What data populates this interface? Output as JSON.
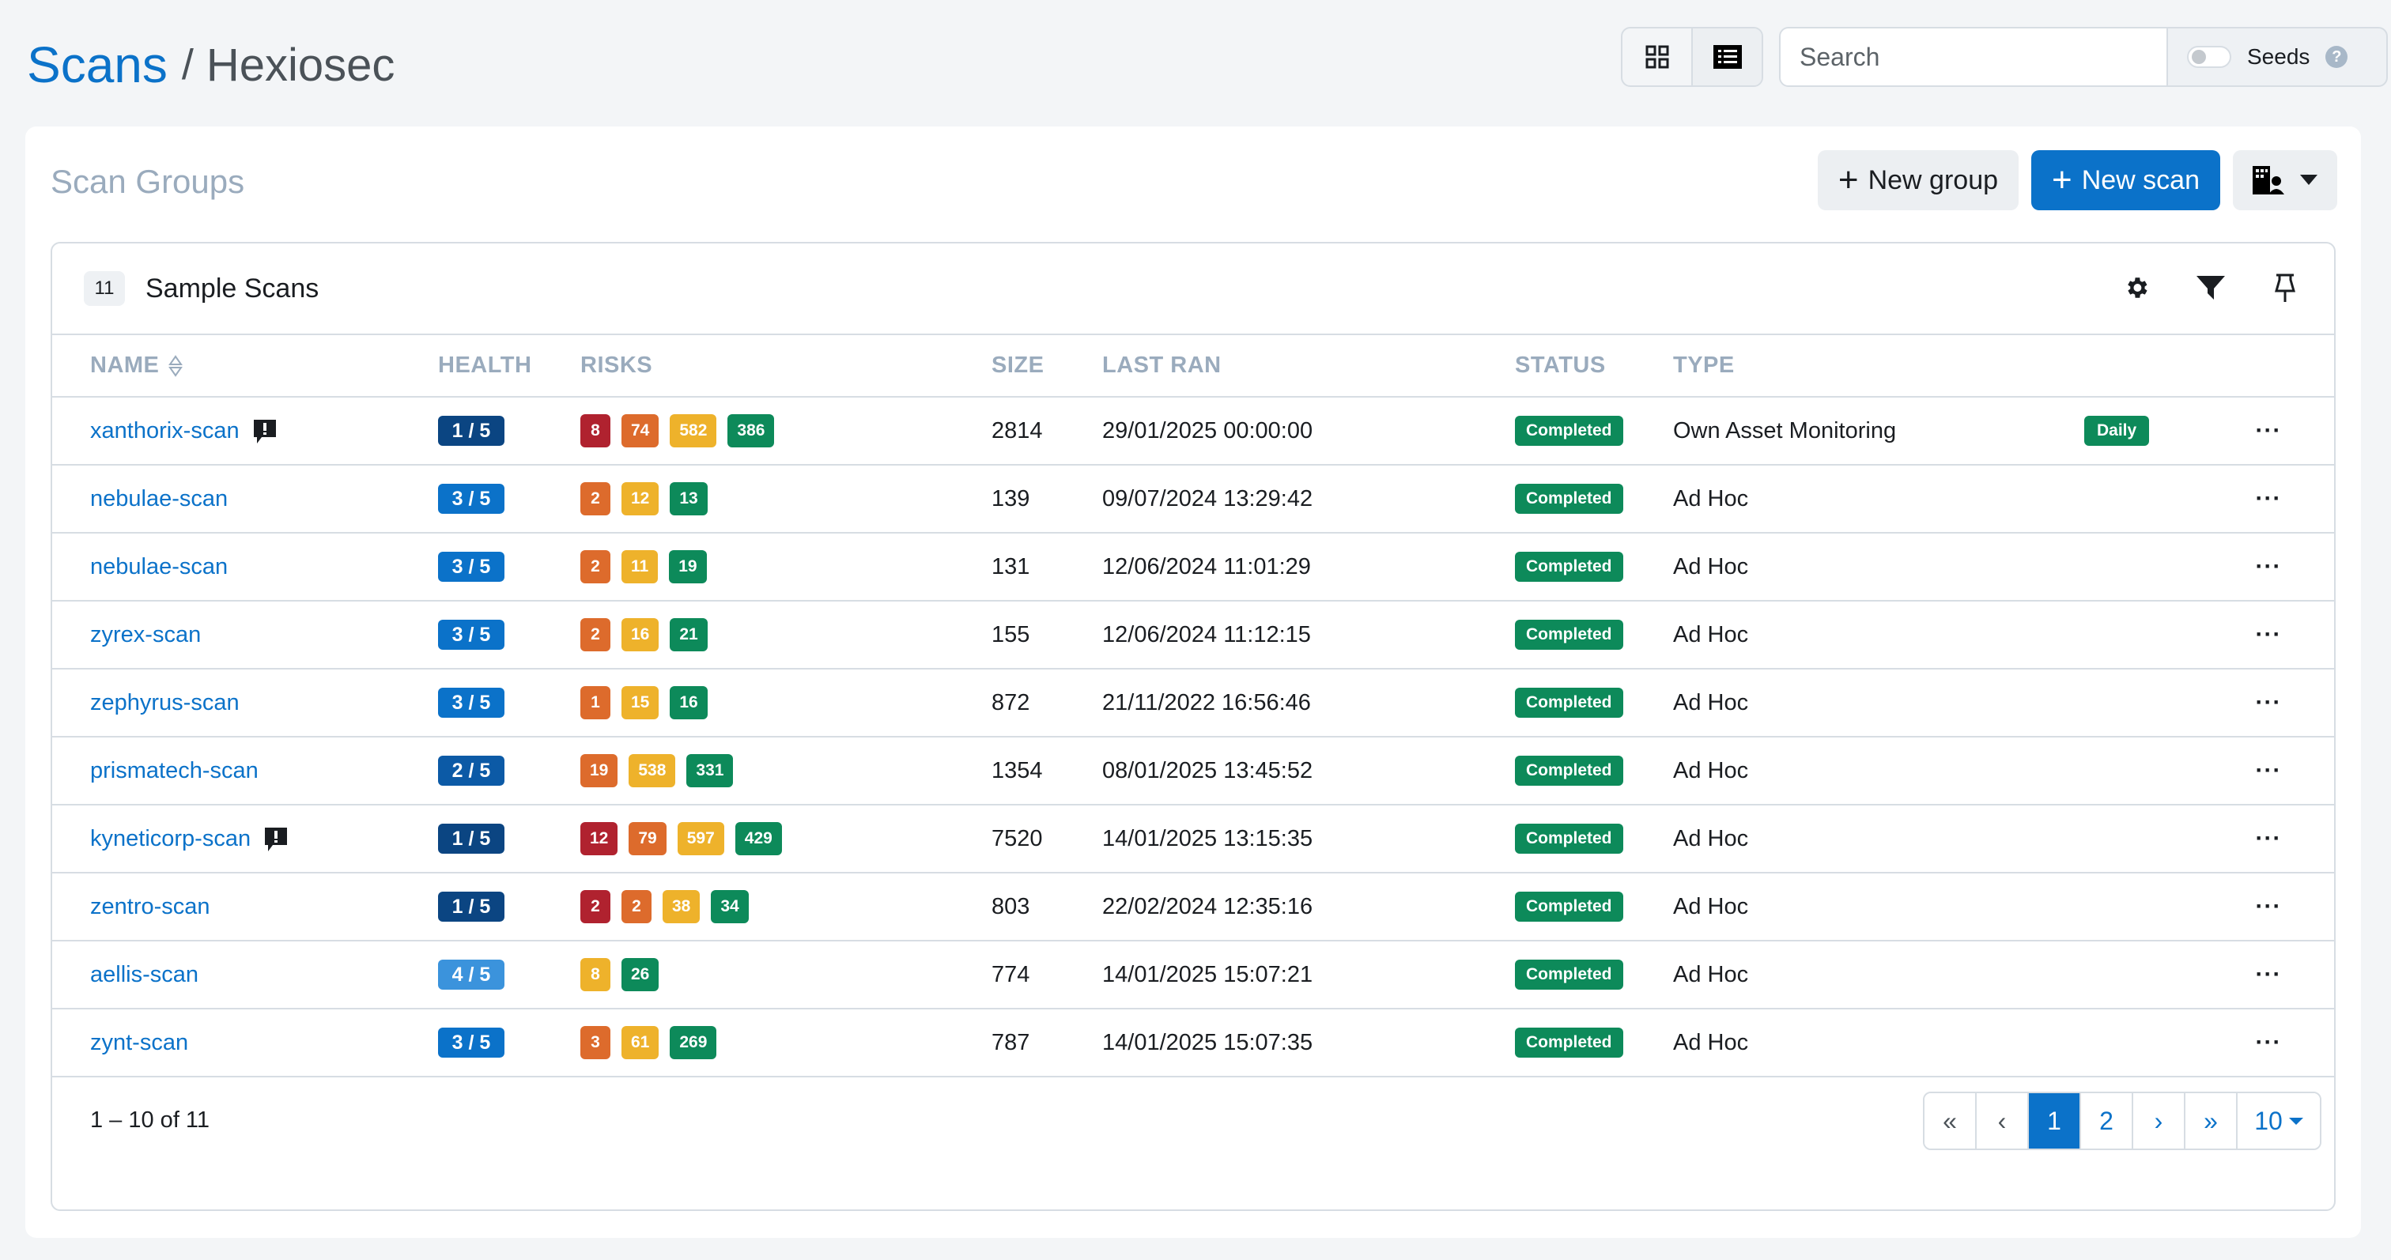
{
  "breadcrumb": {
    "parent": "Scans",
    "separator": "/",
    "current": "Hexiosec"
  },
  "toolbar": {
    "view_grid": "grid-view-icon",
    "view_list": "list-view-icon",
    "search_placeholder": "Search",
    "seeds_label": "Seeds",
    "seeds_help": "?"
  },
  "card": {
    "title": "Scan Groups",
    "new_group": "New group",
    "new_scan": "New scan",
    "plus": "+"
  },
  "group": {
    "count": "11",
    "name": "Sample Scans",
    "icons": [
      "gear-icon",
      "filter-icon",
      "pin-icon"
    ]
  },
  "columns": [
    "NAME",
    "HEALTH",
    "RISKS",
    "SIZE",
    "LAST RAN",
    "STATUS",
    "TYPE"
  ],
  "colors": {
    "critical": "#b0222f",
    "high": "#dd6b2c",
    "medium": "#eeb22b",
    "low": "#0d8a5a",
    "health_1": "#0b4582",
    "health_2": "#0c5aa6",
    "health_3": "#0b72c9",
    "health_4": "#3b93dc"
  },
  "rows": [
    {
      "name": "xanthorix-scan",
      "comment": true,
      "health": "1 / 5",
      "health_level": 1,
      "risks": [
        {
          "v": "8",
          "s": "critical"
        },
        {
          "v": "74",
          "s": "high"
        },
        {
          "v": "582",
          "s": "medium"
        },
        {
          "v": "386",
          "s": "low"
        }
      ],
      "size": "2814",
      "last_ran": "29/01/2025 00:00:00",
      "status": "Completed",
      "type": "Own Asset Monitoring",
      "frequency": "Daily"
    },
    {
      "name": "nebulae-scan",
      "comment": false,
      "health": "3 / 5",
      "health_level": 3,
      "risks": [
        {
          "v": "2",
          "s": "high"
        },
        {
          "v": "12",
          "s": "medium"
        },
        {
          "v": "13",
          "s": "low"
        }
      ],
      "size": "139",
      "last_ran": "09/07/2024 13:29:42",
      "status": "Completed",
      "type": "Ad Hoc",
      "frequency": ""
    },
    {
      "name": "nebulae-scan",
      "comment": false,
      "health": "3 / 5",
      "health_level": 3,
      "risks": [
        {
          "v": "2",
          "s": "high"
        },
        {
          "v": "11",
          "s": "medium"
        },
        {
          "v": "19",
          "s": "low"
        }
      ],
      "size": "131",
      "last_ran": "12/06/2024 11:01:29",
      "status": "Completed",
      "type": "Ad Hoc",
      "frequency": ""
    },
    {
      "name": "zyrex-scan",
      "comment": false,
      "health": "3 / 5",
      "health_level": 3,
      "risks": [
        {
          "v": "2",
          "s": "high"
        },
        {
          "v": "16",
          "s": "medium"
        },
        {
          "v": "21",
          "s": "low"
        }
      ],
      "size": "155",
      "last_ran": "12/06/2024 11:12:15",
      "status": "Completed",
      "type": "Ad Hoc",
      "frequency": ""
    },
    {
      "name": "zephyrus-scan",
      "comment": false,
      "health": "3 / 5",
      "health_level": 3,
      "risks": [
        {
          "v": "1",
          "s": "high"
        },
        {
          "v": "15",
          "s": "medium"
        },
        {
          "v": "16",
          "s": "low"
        }
      ],
      "size": "872",
      "last_ran": "21/11/2022 16:56:46",
      "status": "Completed",
      "type": "Ad Hoc",
      "frequency": ""
    },
    {
      "name": "prismatech-scan",
      "comment": false,
      "health": "2 / 5",
      "health_level": 2,
      "risks": [
        {
          "v": "19",
          "s": "high"
        },
        {
          "v": "538",
          "s": "medium"
        },
        {
          "v": "331",
          "s": "low"
        }
      ],
      "size": "1354",
      "last_ran": "08/01/2025 13:45:52",
      "status": "Completed",
      "type": "Ad Hoc",
      "frequency": ""
    },
    {
      "name": "kyneticorp-scan",
      "comment": true,
      "health": "1 / 5",
      "health_level": 1,
      "risks": [
        {
          "v": "12",
          "s": "critical"
        },
        {
          "v": "79",
          "s": "high"
        },
        {
          "v": "597",
          "s": "medium"
        },
        {
          "v": "429",
          "s": "low"
        }
      ],
      "size": "7520",
      "last_ran": "14/01/2025 13:15:35",
      "status": "Completed",
      "type": "Ad Hoc",
      "frequency": ""
    },
    {
      "name": "zentro-scan",
      "comment": false,
      "health": "1 / 5",
      "health_level": 1,
      "risks": [
        {
          "v": "2",
          "s": "critical"
        },
        {
          "v": "2",
          "s": "high"
        },
        {
          "v": "38",
          "s": "medium"
        },
        {
          "v": "34",
          "s": "low"
        }
      ],
      "size": "803",
      "last_ran": "22/02/2024 12:35:16",
      "status": "Completed",
      "type": "Ad Hoc",
      "frequency": ""
    },
    {
      "name": "aellis-scan",
      "comment": false,
      "health": "4 / 5",
      "health_level": 4,
      "risks": [
        {
          "v": "8",
          "s": "medium"
        },
        {
          "v": "26",
          "s": "low"
        }
      ],
      "size": "774",
      "last_ran": "14/01/2025 15:07:21",
      "status": "Completed",
      "type": "Ad Hoc",
      "frequency": ""
    },
    {
      "name": "zynt-scan",
      "comment": false,
      "health": "3 / 5",
      "health_level": 3,
      "risks": [
        {
          "v": "3",
          "s": "high"
        },
        {
          "v": "61",
          "s": "medium"
        },
        {
          "v": "269",
          "s": "low"
        }
      ],
      "size": "787",
      "last_ran": "14/01/2025 15:07:35",
      "status": "Completed",
      "type": "Ad Hoc",
      "frequency": ""
    }
  ],
  "more_label": "···",
  "footer": {
    "range": "1 – 10 of 11",
    "pager": {
      "first": "«",
      "prev": "‹",
      "pages": [
        "1",
        "2"
      ],
      "current": "1",
      "next": "›",
      "last": "»",
      "page_size": "10"
    }
  }
}
